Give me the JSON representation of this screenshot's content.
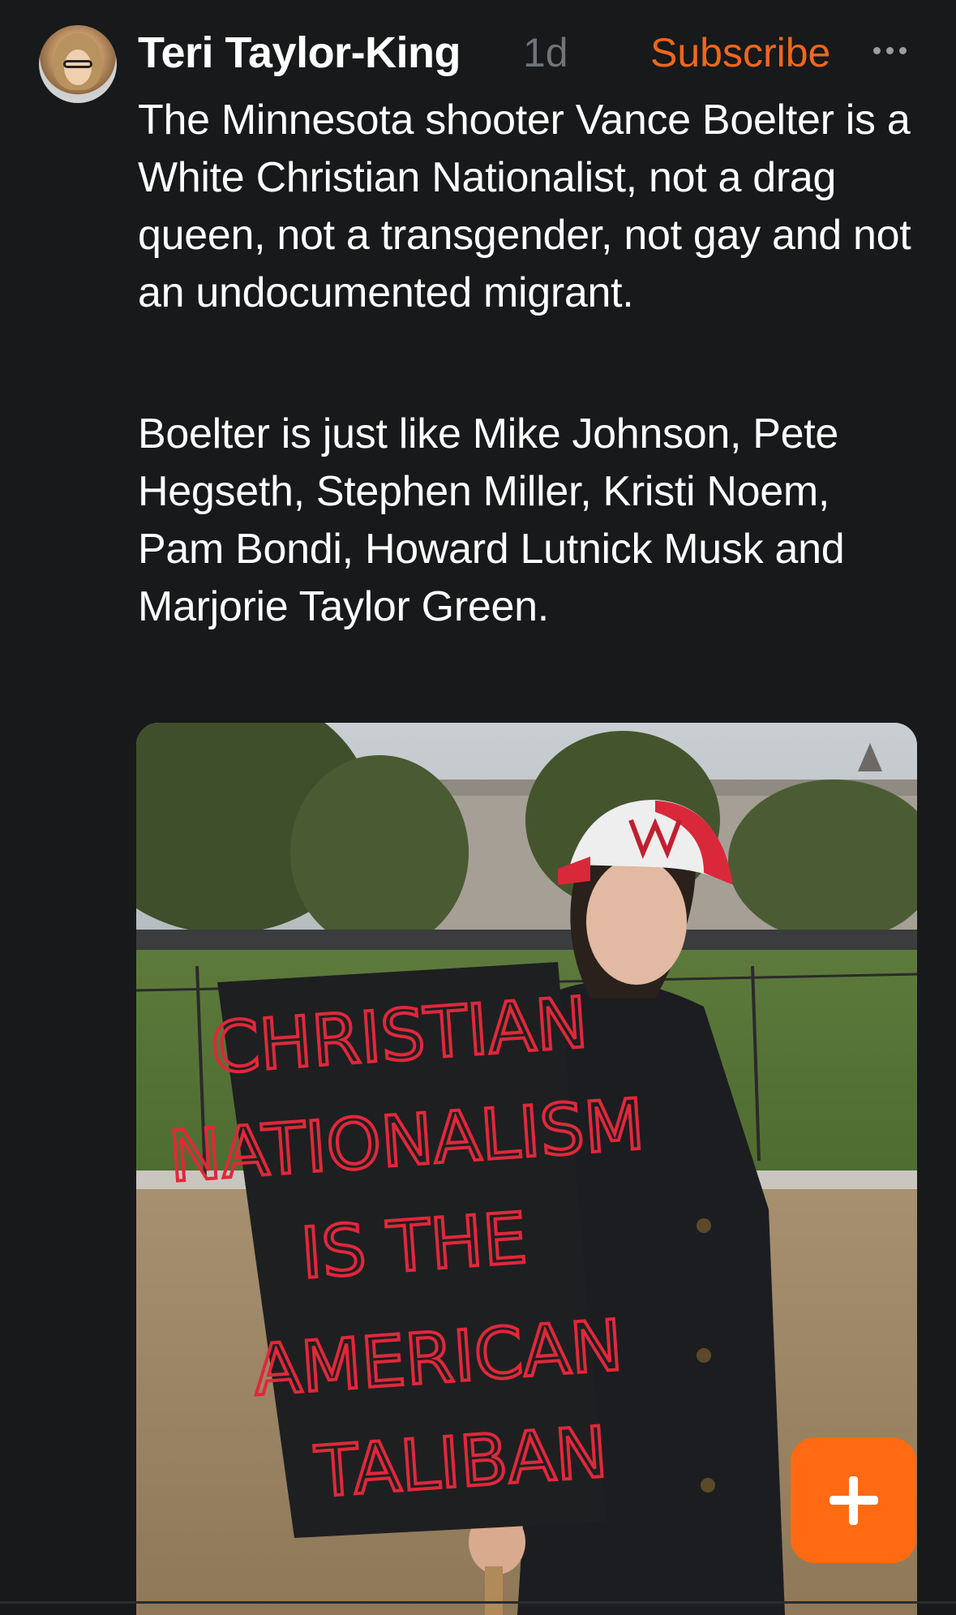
{
  "post": {
    "author": "Teri Taylor-King",
    "time": "1d",
    "subscribe_label": "Subscribe",
    "paragraphs": [
      "The Minnesota shooter Vance Boelter is a White Christian Nationalist, not a drag queen, not a transgender, not gay and not an undocumented migrant.",
      "Boelter is just like Mike Johnson, Pete Hegseth, Stephen Miller, Kristi Noem, Pam Bondi, Howard Lutnick Musk and Marjorie Taylor Green."
    ],
    "image": {
      "sign_lines": [
        "CHRISTIAN",
        "NATIONALISM",
        "IS THE",
        "AMERICAN",
        "TALIBAN"
      ]
    }
  },
  "icons": {
    "more": "more-horizontal-icon",
    "compose": "plus-icon"
  },
  "colors": {
    "background": "#17191b",
    "accent": "#f2661c",
    "fab": "#ff6a13",
    "muted": "#6f7478",
    "sign_text": "#e0283a"
  }
}
